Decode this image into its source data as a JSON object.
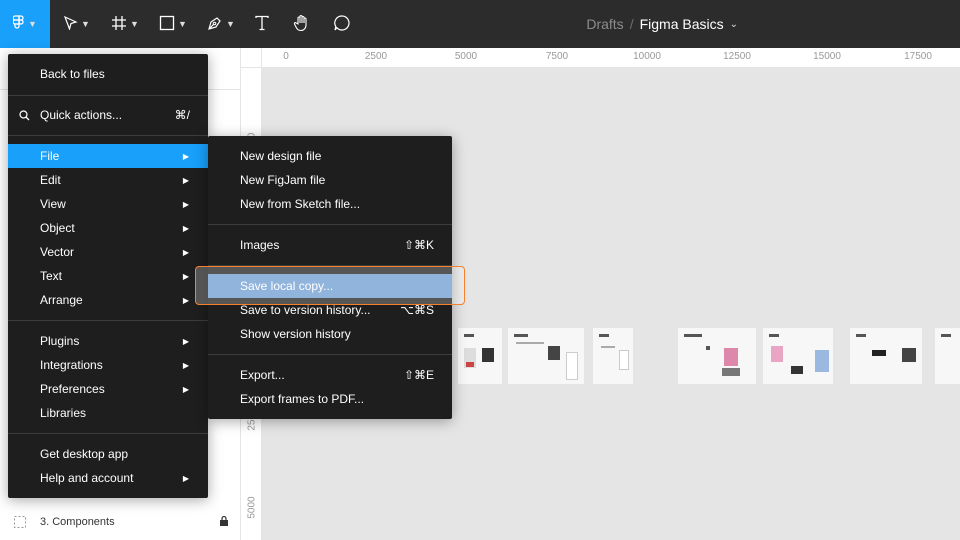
{
  "toolbar": {
    "breadcrumb_folder": "Drafts",
    "breadcrumb_separator": "/",
    "file_name": "Figma Basics",
    "tools": [
      "figma-menu-icon",
      "move-icon",
      "frame-icon",
      "rectangle-icon",
      "pen-icon",
      "text-icon",
      "hand-icon",
      "comment-icon"
    ],
    "accent": "#18a0fb"
  },
  "left_panel": {
    "page_item": "3. Components"
  },
  "ruler": {
    "top": [
      "0",
      "2500",
      "5000",
      "7500",
      "10000",
      "12500",
      "15000",
      "17500"
    ],
    "left": [
      "0",
      "2500",
      "5000"
    ]
  },
  "main_menu": {
    "back": "Back to files",
    "quick_actions": "Quick actions...",
    "quick_actions_shortcut": "⌘/",
    "file": "File",
    "edit": "Edit",
    "view": "View",
    "object": "Object",
    "vector": "Vector",
    "text": "Text",
    "arrange": "Arrange",
    "plugins": "Plugins",
    "integrations": "Integrations",
    "preferences": "Preferences",
    "libraries": "Libraries",
    "get_desktop": "Get desktop app",
    "help": "Help and account"
  },
  "file_menu": {
    "new_design": "New design file",
    "new_figjam": "New FigJam file",
    "new_sketch": "New from Sketch file...",
    "images": "Images",
    "images_shortcut": "⇧⌘K",
    "save_local": "Save local copy...",
    "save_version": "Save to version history...",
    "save_version_shortcut": "⌥⌘S",
    "show_version": "Show version history",
    "export": "Export...",
    "export_shortcut": "⇧⌘E",
    "export_pdf": "Export frames to PDF..."
  },
  "colors": {
    "active_item": "#18a0fb",
    "highlighted_item": "#6d9bd1",
    "focus_ring": "#f5812f"
  }
}
